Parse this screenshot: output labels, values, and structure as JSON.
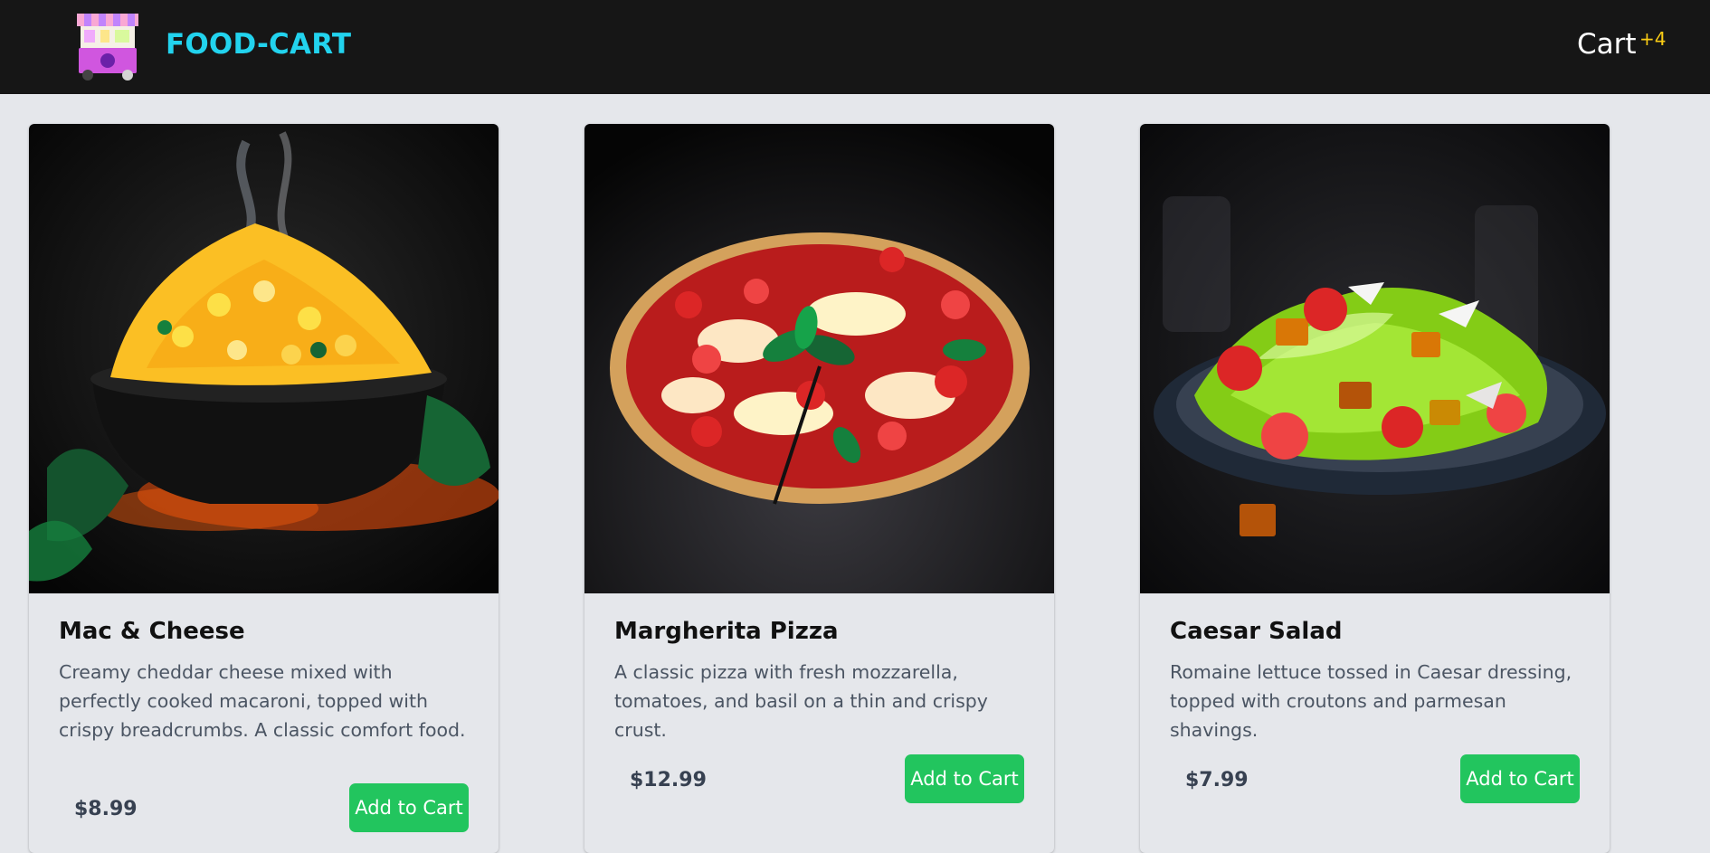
{
  "header": {
    "brand": "FOOD-CART",
    "cart_label": "Cart",
    "cart_badge": "+4",
    "logo_icon": "food-cart-logo-icon"
  },
  "products": [
    {
      "title": "Mac & Cheese",
      "description": "Creamy cheddar cheese mixed with perfectly cooked macaroni, topped with crispy breadcrumbs. A classic comfort food.",
      "price": "$8.99",
      "button_label": "Add to Cart"
    },
    {
      "title": "Margherita Pizza",
      "description": "A classic pizza with fresh mozzarella, tomatoes, and basil on a thin and crispy crust.",
      "price": "$12.99",
      "button_label": "Add to Cart"
    },
    {
      "title": "Caesar Salad",
      "description": "Romaine lettuce tossed in Caesar dressing, topped with croutons and parmesan shavings.",
      "price": "$7.99",
      "button_label": "Add to Cart"
    }
  ],
  "colors": {
    "navbar_bg": "#161616",
    "brand": "#22d3ee",
    "badge": "#facc15",
    "button": "#22c55e",
    "page_bg": "#e5e7eb"
  }
}
